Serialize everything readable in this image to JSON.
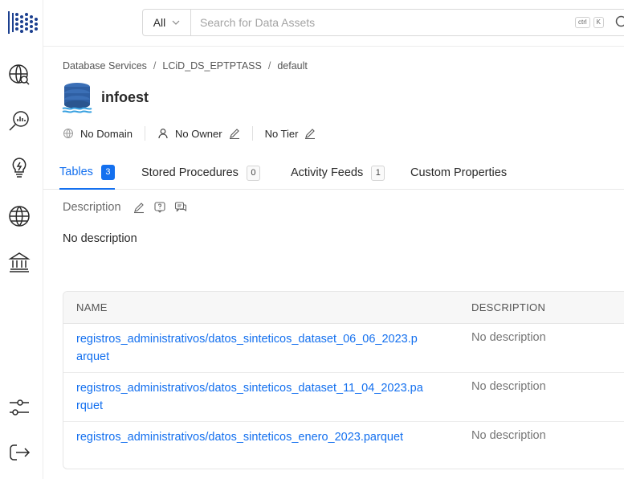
{
  "search": {
    "filter_label": "All",
    "placeholder": "Search for Data Assets",
    "shortcut_key1": "ctrl",
    "shortcut_key2": "K"
  },
  "breadcrumb": [
    "Database Services",
    "LCiD_DS_EPTPTASS",
    "default"
  ],
  "entity": {
    "name": "infoest"
  },
  "meta": {
    "domain": "No Domain",
    "owner": "No Owner",
    "tier": "No Tier"
  },
  "tabs": [
    {
      "label": "Tables",
      "count": "3"
    },
    {
      "label": "Stored Procedures",
      "count": "0"
    },
    {
      "label": "Activity Feeds",
      "count": "1"
    },
    {
      "label": "Custom Properties",
      "count": ""
    }
  ],
  "description": {
    "title": "Description",
    "text": "No description"
  },
  "table": {
    "headers": [
      "NAME",
      "DESCRIPTION"
    ],
    "rows": [
      {
        "name": "registros_administrativos/datos_sinteticos_dataset_06_06_2023.parquet",
        "description": "No description"
      },
      {
        "name": "registros_administrativos/datos_sinteticos_dataset_11_04_2023.parquet",
        "description": "No description"
      },
      {
        "name": "registros_administrativos/datos_sinteticos_enero_2023.parquet",
        "description": "No description"
      }
    ]
  },
  "colors": {
    "accent": "#1470ef",
    "text": "#292929",
    "muted": "#757575"
  },
  "icons": [
    "app-logo",
    "explore-icon",
    "data-insights-icon",
    "data-quality-icon",
    "domains-icon",
    "governance-icon",
    "settings-icon",
    "logout-icon",
    "search-icon",
    "database-icon",
    "domain-icon",
    "owner-icon",
    "edit-icon",
    "request-icon",
    "conversation-icon"
  ]
}
